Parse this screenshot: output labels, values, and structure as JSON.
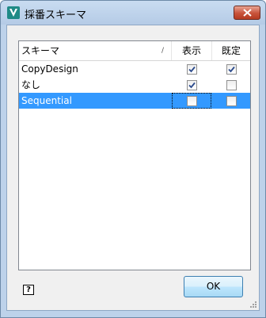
{
  "window": {
    "title": "採番スキーマ"
  },
  "list": {
    "columns": {
      "name": "スキーマ",
      "show": "表示",
      "default": "既定"
    },
    "rows": [
      {
        "label": "CopyDesign",
        "show": true,
        "default": true,
        "selected": false
      },
      {
        "label": "なし",
        "show": true,
        "default": false,
        "selected": false
      },
      {
        "label": "Sequential",
        "show": false,
        "default": false,
        "selected": true
      }
    ]
  },
  "buttons": {
    "ok_label": "OK",
    "help_label": "?"
  },
  "colors": {
    "selection": "#3399ff",
    "titlebar": "#bdd2ea",
    "close": "#c8523a"
  }
}
